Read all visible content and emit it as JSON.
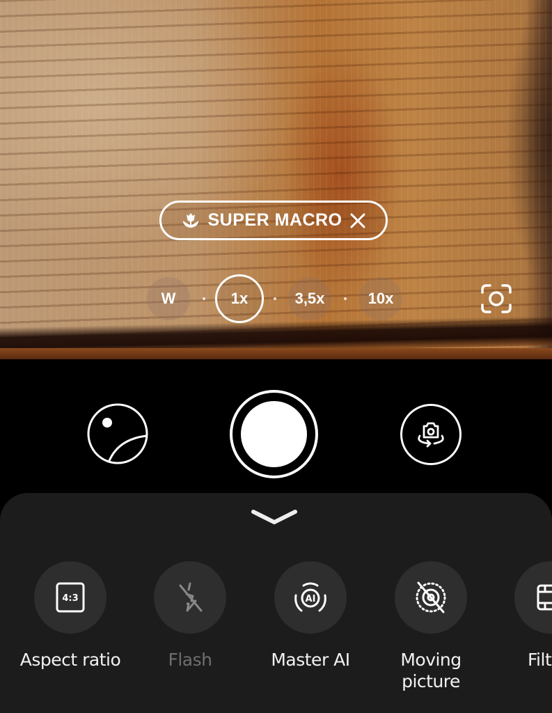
{
  "mode_badge": {
    "label": "SUPER MACRO",
    "icon": "flower-macro-icon",
    "close_icon": "close-icon"
  },
  "zoom_levels": [
    {
      "label": "W",
      "active": false
    },
    {
      "label": "1x",
      "active": true
    },
    {
      "label": "3,5x",
      "active": false
    },
    {
      "label": "10x",
      "active": false
    }
  ],
  "lens_icon": "lens-focus-icon",
  "controls": {
    "gallery_icon": "gallery-thumbnail-icon",
    "shutter_icon": "shutter-icon",
    "switch_camera_icon": "switch-camera-icon"
  },
  "sheet": {
    "collapse_icon": "chevron-down-icon",
    "options": [
      {
        "label": "Aspect ratio",
        "icon": "aspect-ratio-icon",
        "icon_text": "4:3",
        "enabled": true
      },
      {
        "label": "Flash",
        "icon": "flash-off-icon",
        "enabled": false
      },
      {
        "label": "Master AI",
        "icon": "master-ai-icon",
        "icon_text": "AI",
        "enabled": true
      },
      {
        "label": "Moving\npicture",
        "label_line1": "Moving",
        "label_line2": "picture",
        "icon": "moving-picture-off-icon",
        "enabled": true
      },
      {
        "label": "Filt",
        "icon": "filter-icon",
        "enabled": true
      }
    ]
  }
}
